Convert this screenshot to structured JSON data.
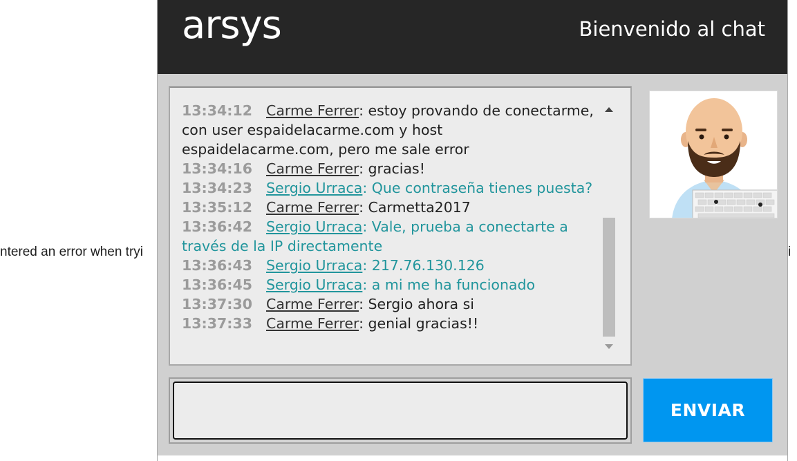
{
  "background": {
    "left_text": "ntered an error when tryi",
    "right_text": "i"
  },
  "header": {
    "logo": "arsys",
    "welcome": "Bienvenido al chat"
  },
  "messages": [
    {
      "time": "13:34:12",
      "author": "Carme Ferrer",
      "role": "client",
      "text": "estoy provando de conectarme, con user espaidelacarme.com y host espaidelacarme.com, pero me sale error"
    },
    {
      "time": "13:34:16",
      "author": "Carme Ferrer",
      "role": "client",
      "text": "gracias!"
    },
    {
      "time": "13:34:23",
      "author": "Sergio Urraca",
      "role": "agent",
      "text": "Que contraseña tienes puesta?"
    },
    {
      "time": "13:35:12",
      "author": "Carme Ferrer",
      "role": "client",
      "text": "Carmetta2017"
    },
    {
      "time": "13:36:42",
      "author": "Sergio Urraca",
      "role": "agent",
      "text": "Vale, prueba a conectarte a través de la IP directamente"
    },
    {
      "time": "13:36:43",
      "author": "Sergio Urraca",
      "role": "agent",
      "text": "217.76.130.126"
    },
    {
      "time": "13:36:45",
      "author": "Sergio Urraca",
      "role": "agent",
      "text": "a mi me ha funcionado"
    },
    {
      "time": "13:37:30",
      "author": "Carme Ferrer",
      "role": "client",
      "text": "Sergio ahora si"
    },
    {
      "time": "13:37:33",
      "author": "Carme Ferrer",
      "role": "client",
      "text": "genial gracias!!"
    }
  ],
  "input": {
    "value": "",
    "placeholder": ""
  },
  "send_button": {
    "label": "ENVIAR"
  },
  "colors": {
    "header_bg": "#262626",
    "agent_text": "#21959c",
    "client_text": "#222222",
    "send_button_bg": "#0096f0",
    "timestamp": "#9b9b9b"
  },
  "icons": {
    "avatar": "agent-avatar-illustration",
    "scroll_up": "triangle-up",
    "scroll_down": "triangle-down"
  }
}
